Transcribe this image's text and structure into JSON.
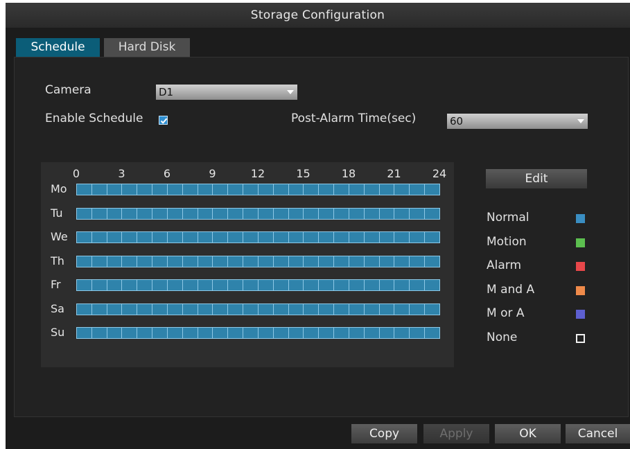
{
  "window": {
    "title": "Storage Configuration"
  },
  "tabs": [
    {
      "label": "Schedule",
      "active": true
    },
    {
      "label": "Hard Disk",
      "active": false
    }
  ],
  "form": {
    "camera_label": "Camera",
    "camera_value": "D1",
    "enable_schedule_label": "Enable Schedule",
    "enable_schedule_checked": true,
    "post_alarm_label": "Post-Alarm Time(sec)",
    "post_alarm_value": "60"
  },
  "schedule": {
    "hour_labels": [
      "0",
      "3",
      "6",
      "9",
      "12",
      "15",
      "18",
      "21",
      "24"
    ],
    "days": [
      "Mo",
      "Tu",
      "We",
      "Th",
      "Fr",
      "Sa",
      "Su"
    ],
    "hours_per_day": 24,
    "fill_mode": "Normal"
  },
  "edit_button": "Edit",
  "legend": [
    {
      "label": "Normal",
      "color": "#3a8ec2"
    },
    {
      "label": "Motion",
      "color": "#5cbf4f"
    },
    {
      "label": "Alarm",
      "color": "#e8474a"
    },
    {
      "label": "M and A",
      "color": "#ef8a4a"
    },
    {
      "label": "M or A",
      "color": "#5d5fd0"
    },
    {
      "label": "None",
      "color": "none"
    }
  ],
  "footer": {
    "copy": "Copy",
    "apply": "Apply",
    "ok": "OK",
    "cancel": "Cancel"
  }
}
